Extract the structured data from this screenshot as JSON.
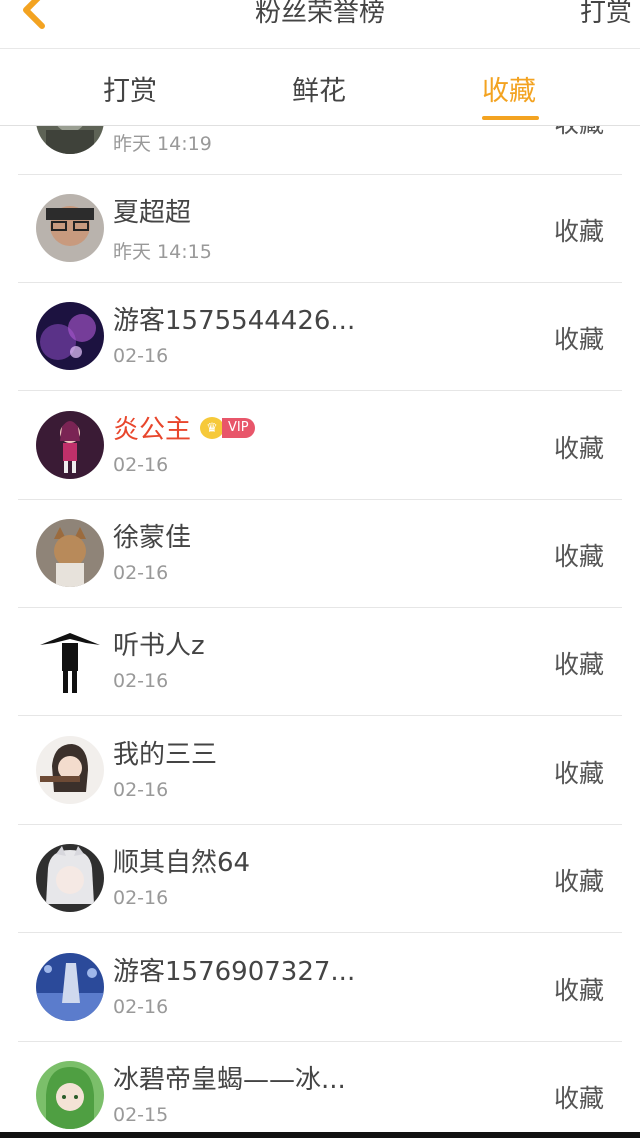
{
  "header": {
    "title": "粉丝荣誉榜",
    "right_label": "打赏"
  },
  "tabs": [
    {
      "label": "打赏",
      "active": false
    },
    {
      "label": "鲜花",
      "active": false
    },
    {
      "label": "收藏",
      "active": true
    }
  ],
  "accent_color": "#f3a321",
  "vip_name_color": "#e8462c",
  "list": [
    {
      "name": "",
      "time": "昨天 14:19",
      "action": "收藏",
      "vip": false
    },
    {
      "name": "夏超超",
      "time": "昨天 14:15",
      "action": "收藏",
      "vip": false
    },
    {
      "name": "游客1575544426...",
      "time": "02-16",
      "action": "收藏",
      "vip": false
    },
    {
      "name": "炎公主",
      "time": "02-16",
      "action": "收藏",
      "vip": true,
      "vip_label": "VIP"
    },
    {
      "name": "徐蒙佳",
      "time": "02-16",
      "action": "收藏",
      "vip": false
    },
    {
      "name": "听书人z",
      "time": "02-16",
      "action": "收藏",
      "vip": false
    },
    {
      "name": "我的三三",
      "time": "02-16",
      "action": "收藏",
      "vip": false
    },
    {
      "name": "顺其自然64",
      "time": "02-16",
      "action": "收藏",
      "vip": false
    },
    {
      "name": "游客1576907327...",
      "time": "02-16",
      "action": "收藏",
      "vip": false
    },
    {
      "name": "冰碧帝皇蝎——冰...",
      "time": "02-15",
      "action": "收藏",
      "vip": false
    }
  ]
}
